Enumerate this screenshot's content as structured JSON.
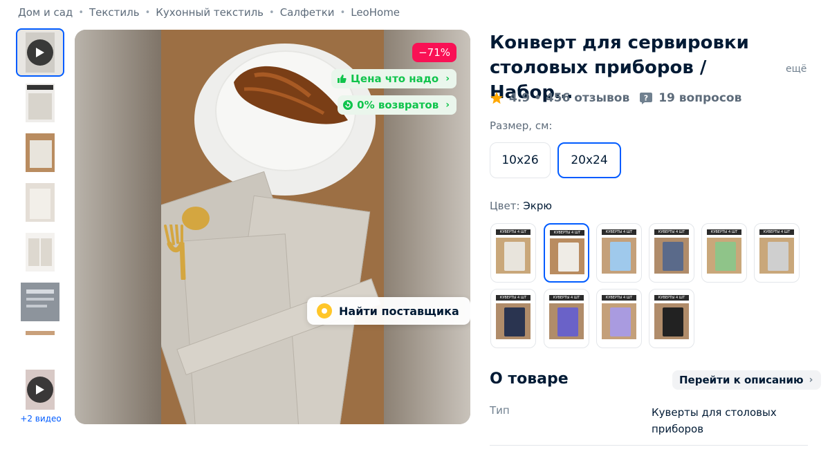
{
  "breadcrumb": [
    "Дом и сад",
    "Текстиль",
    "Кухонный текстиль",
    "Салфетки",
    "LeoHome"
  ],
  "gallery": {
    "more_videos": "+2 видео"
  },
  "badges": {
    "discount": "−71%",
    "price_ok": "Цена что надо",
    "returns": "0% возвратов",
    "find_supplier": "Найти поставщика"
  },
  "product": {
    "title": "Конверт для сервировки столовых приборов / Набор…",
    "title_more": "ещё",
    "rating": "4.9",
    "reviews": "456 отзывов",
    "questions": "19 вопросов"
  },
  "size": {
    "label": "Размер, см:",
    "options": [
      "10x26",
      "20x24"
    ],
    "selected": "20x24"
  },
  "color": {
    "label": "Цвет:",
    "value": "Экрю",
    "swatch_caption": "КУВЕРТЫ 4 ШТ",
    "swatches": [
      {
        "bg": "#c9a77a",
        "linen": "#e8e4dc"
      },
      {
        "bg": "#b98c60",
        "linen": "#efece6"
      },
      {
        "bg": "#c4a07a",
        "linen": "#9fc9ec"
      },
      {
        "bg": "#b08c6a",
        "linen": "#5a6a8a"
      },
      {
        "bg": "#c9a77a",
        "linen": "#8fc489"
      },
      {
        "bg": "#c9a77a",
        "linen": "#cfcfcf"
      },
      {
        "bg": "#b08c6a",
        "linen": "#2a3450"
      },
      {
        "bg": "#b08c6a",
        "linen": "#6a62c8"
      },
      {
        "bg": "#c4a07a",
        "linen": "#a99be0"
      },
      {
        "bg": "#b08c6a",
        "linen": "#222222"
      }
    ]
  },
  "about": {
    "title": "О товаре",
    "link": "Перейти к описанию",
    "spec_key": "Тип",
    "spec_value": "Куверты для столовых приборов"
  },
  "colors": {
    "accent": "#005bff",
    "discount": "#f91155",
    "green": "#10c44c",
    "star": "#ffa800"
  }
}
